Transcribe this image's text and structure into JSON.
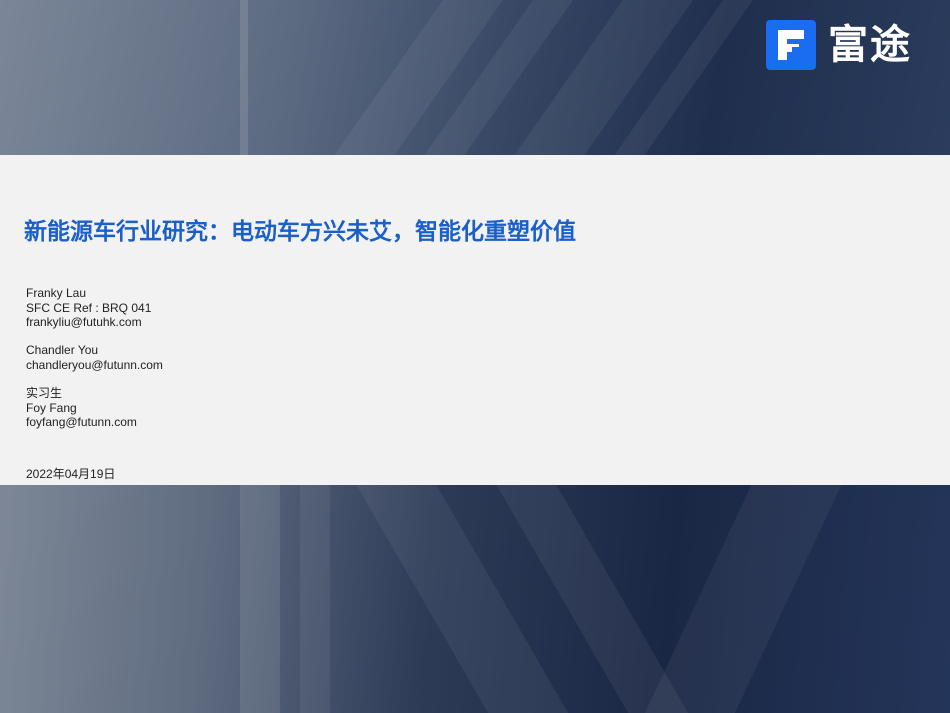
{
  "brand": {
    "name": "富途",
    "icon": "futu-f-logo-icon",
    "accent": "#1a6cf0"
  },
  "title": "新能源车行业研究：电动车方兴未艾，智能化重塑价值",
  "authors": [
    {
      "lines": [
        "Franky Lau",
        "SFC CE Ref : BRQ 041",
        "frankyliu@futuhk.com"
      ]
    },
    {
      "lines": [
        "Chandler You",
        "chandleryou@futunn.com"
      ]
    },
    {
      "lines": [
        "实习生",
        "Foy Fang",
        "foyfang@futunn.com"
      ]
    }
  ],
  "date": "2022年04月19日",
  "colors": {
    "title": "#1b5fc9",
    "panel": "#f2f2f2"
  }
}
